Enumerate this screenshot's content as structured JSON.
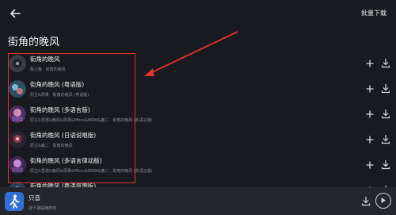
{
  "header": {
    "batch_download_label": "批量下载"
  },
  "page": {
    "title": "街角的晚风"
  },
  "songs": [
    {
      "title": "街角的晚风",
      "subtitle": "陈小春 · 街角的晚风"
    },
    {
      "title": "街角的晚风 (粤语版)",
      "subtitle": "原主&周果 · 街角的晚风 (粤语版)"
    },
    {
      "title": "街角的晚风 (多语言版)",
      "subtitle": "原主&雪诺&晚风&周果&Mitsu&MRW&鹿二 · 街角的晚风 (多语言版)"
    },
    {
      "title": "街角的晚风 (日语说唱版)",
      "subtitle": "原主&鹿二 · 街角的晚风"
    },
    {
      "title": "街角的晚风 (多语言律动版)",
      "subtitle": "原主&雪诺&晚风&周果&Mitsu&MRW&鹿二 · 街角的晚风 (多语言版)"
    },
    {
      "title": "街角的晚风 (粤语氛围版)",
      "subtitle": ""
    }
  ],
  "player": {
    "title": "只音",
    "subtitle": "选个歌曲播放吧"
  },
  "colors": {
    "highlight": "#e0312f",
    "background": "#181a1f",
    "bar": "#23262c"
  },
  "icons": {
    "back": "arrow-left-icon",
    "add": "plus-icon",
    "download": "download-icon",
    "play": "play-icon",
    "avatar": "walking-person-icon"
  }
}
